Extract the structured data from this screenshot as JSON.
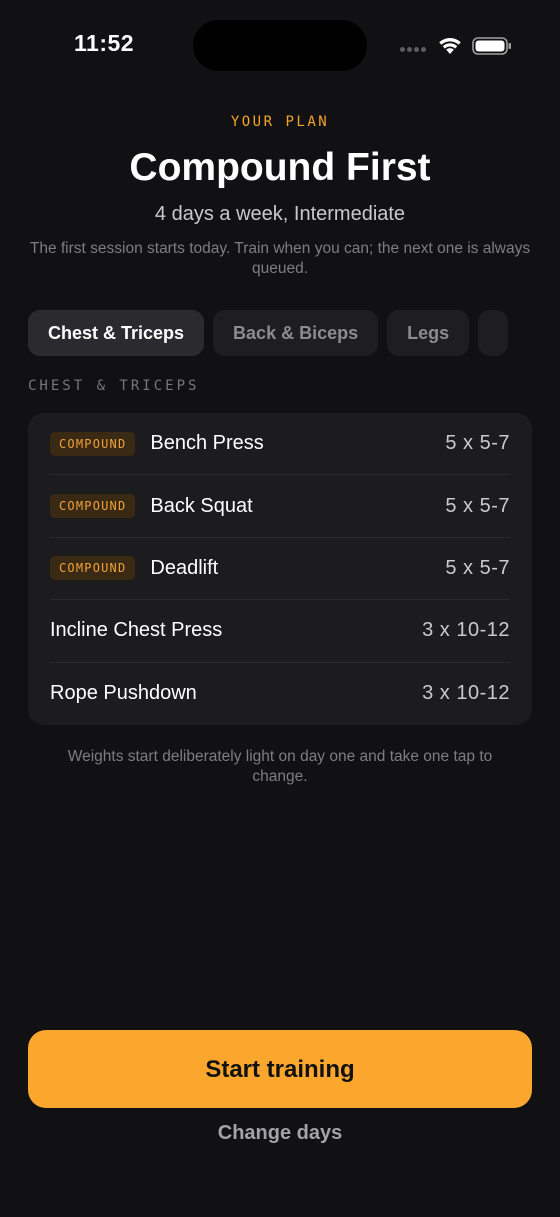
{
  "status_bar": {
    "time": "11:52",
    "icons": [
      "signal-dots-icon",
      "wifi-icon",
      "battery-icon"
    ]
  },
  "header": {
    "eyebrow": "YOUR PLAN",
    "title": "Compound First",
    "subtitle": "4 days a week, Intermediate",
    "description": "The first session starts today. Train when you can; the next one is always queued."
  },
  "tabs": [
    {
      "label": "Chest & Triceps",
      "active": true
    },
    {
      "label": "Back & Biceps",
      "active": false
    },
    {
      "label": "Legs",
      "active": false
    }
  ],
  "section": {
    "label": "CHEST & TRICEPS"
  },
  "exercises": [
    {
      "badge": "COMPOUND",
      "name": "Bench Press",
      "sets": "5 x 5-7"
    },
    {
      "badge": "COMPOUND",
      "name": "Back Squat",
      "sets": "5 x 5-7"
    },
    {
      "badge": "COMPOUND",
      "name": "Deadlift",
      "sets": "5 x 5-7"
    },
    {
      "badge": "",
      "name": "Incline Chest Press",
      "sets": "3 x 10-12"
    },
    {
      "badge": "",
      "name": "Rope Pushdown",
      "sets": "3 x 10-12"
    }
  ],
  "note": "Weights start deliberately light on day one and take one tap to change.",
  "actions": {
    "primary_label": "Start training",
    "secondary_label": "Change days"
  },
  "colors": {
    "accent": "#fba72d",
    "background": "#111113",
    "card": "#1c1c1f",
    "badge_bg": "#3a2a14",
    "badge_text": "#f0a13a"
  }
}
